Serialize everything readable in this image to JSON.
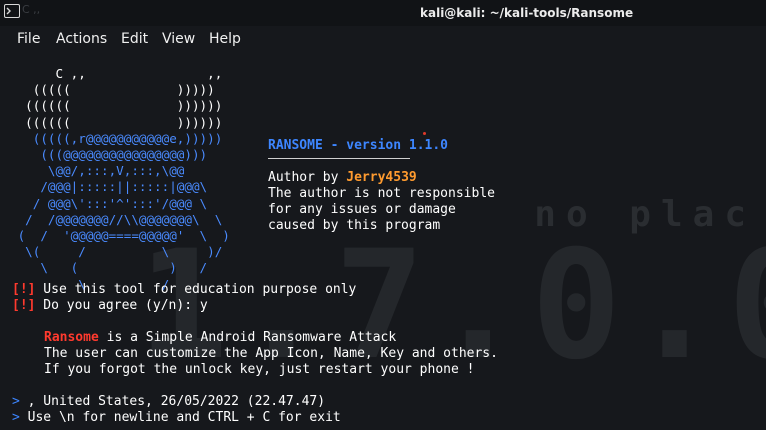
{
  "window": {
    "title": "kali@kali: ~/kali-tools/Ransome",
    "background_tab_label": "C ,,"
  },
  "menu": {
    "items": [
      "File",
      "Actions",
      "Edit",
      "View",
      "Help"
    ]
  },
  "art": {
    "lines": [
      "      C ,,                ,,",
      "   (((((              )))))",
      "  ((((((              ))))))",
      "  ((((((              ))))))",
      "   (((((,r@@@@@@@@@@@e,)))))",
      "    (((@@@@@@@@@@@@@@@@)))",
      "     \\@@/,:::,V,:::,\\@@",
      "    /@@@|:::::||:::::|@@@\\",
      "   / @@@\\':::'^':::'/@@@ \\",
      "  /  /@@@@@@@//\\\\@@@@@@@\\  \\",
      " (  /  '@@@@@====@@@@@'  \\  )",
      "  \\(     /          \\     )/",
      "    \\   (            )   /",
      "         \\          /"
    ]
  },
  "header": {
    "version_text": "RANSOME - version 1.1.0",
    "author_prefix": "Author by ",
    "author_name": "Jerry4539",
    "disclaimer_1": "The author is not responsible",
    "disclaimer_2": "for any issues or damage",
    "disclaimer_3": "caused by this program"
  },
  "warnings": {
    "tag": "[!]",
    "line_1": " Use this tool for education purpose only",
    "line_2": " Do you agree (y/n): y"
  },
  "description": {
    "name": "Ransome",
    "line_1_rest": " is a Simple Android Ransomware Attack",
    "line_2": "The user can customize the App Icon, Name, Key and others.",
    "line_3": "If you forgot the unlock key, just restart your phone !"
  },
  "output": {
    "prompt": ">",
    "line_1": " , United States, 26/05/2022 (22.47.47)",
    "line_2": " Use \\n for newline and CTRL + C for exit"
  },
  "colors": {
    "accent_blue": "#3d86ff",
    "author_orange": "#ff9b2f",
    "warning_red": "#ff3a2e",
    "background": "#16181c"
  }
}
